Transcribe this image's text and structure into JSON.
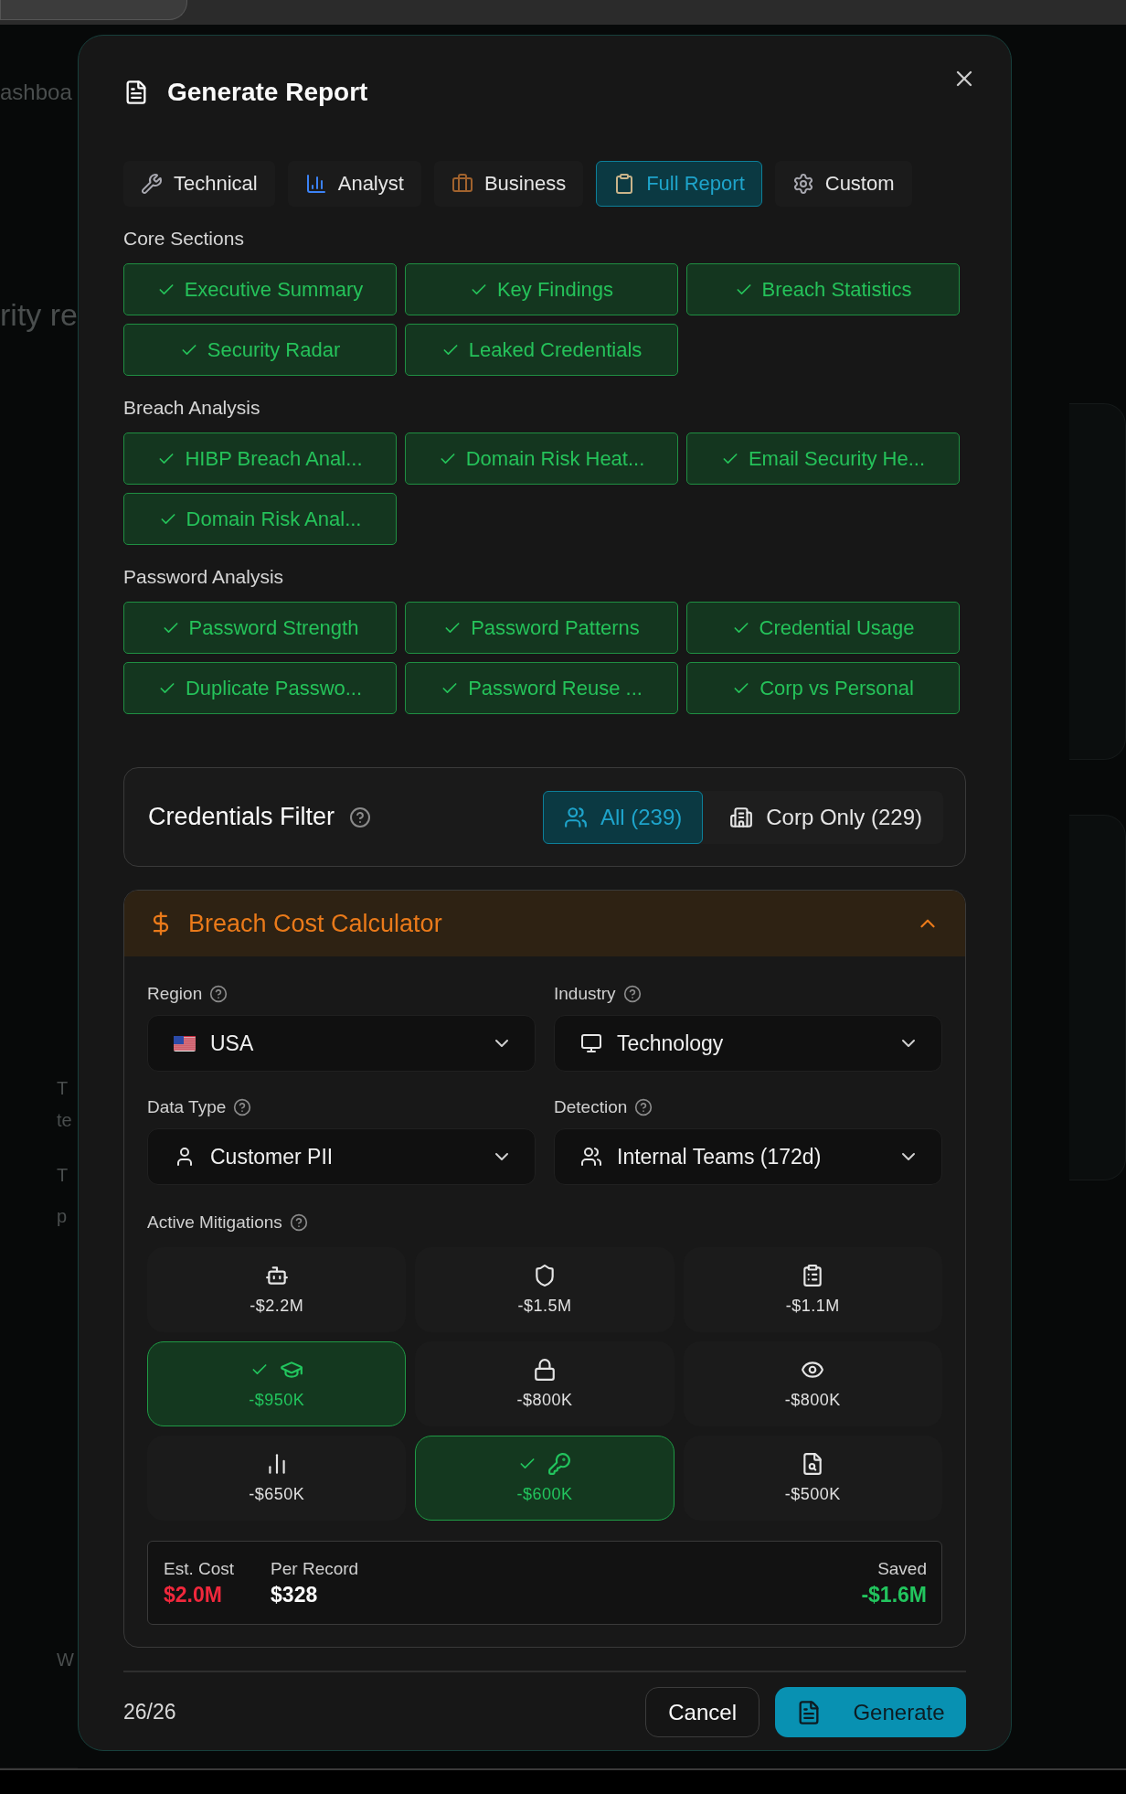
{
  "background": {
    "texts": [
      {
        "kind": "nav",
        "text": "ashboa"
      },
      {
        "kind": "heading",
        "text": "rity re"
      },
      {
        "kind": "line",
        "text": "T"
      },
      {
        "kind": "line",
        "text": "te"
      },
      {
        "kind": "line",
        "text": "T"
      },
      {
        "kind": "line",
        "text": "p"
      },
      {
        "kind": "line",
        "text": "W"
      }
    ]
  },
  "dialog": {
    "title": "Generate Report",
    "tabs": [
      {
        "kind": "wrench",
        "label": "Technical",
        "selected": false
      },
      {
        "kind": "chart",
        "label": "Analyst",
        "selected": false
      },
      {
        "kind": "briefcase",
        "label": "Business",
        "selected": false
      },
      {
        "kind": "clipboard",
        "label": "Full Report",
        "selected": true
      },
      {
        "kind": "gear",
        "label": "Custom",
        "selected": false
      }
    ],
    "sections": [
      {
        "title": "Core Sections",
        "items": [
          {
            "label": "Executive Summary",
            "checked": true
          },
          {
            "label": "Key Findings",
            "checked": true
          },
          {
            "label": "Breach Statistics",
            "checked": true
          },
          {
            "label": "Security Radar",
            "checked": true
          },
          {
            "label": "Leaked Credentials",
            "checked": true
          }
        ]
      },
      {
        "title": "Breach Analysis",
        "items": [
          {
            "label": "HIBP Breach Anal...",
            "checked": true
          },
          {
            "label": "Domain Risk Heat...",
            "checked": true
          },
          {
            "label": "Email Security He...",
            "checked": true
          },
          {
            "label": "Domain Risk Anal...",
            "checked": true
          }
        ]
      },
      {
        "title": "Password Analysis",
        "items": [
          {
            "label": "Password Strength",
            "checked": true
          },
          {
            "label": "Password Patterns",
            "checked": true
          },
          {
            "label": "Credential Usage",
            "checked": true
          },
          {
            "label": "Duplicate Passwo...",
            "checked": true
          },
          {
            "label": "Password Reuse ...",
            "checked": true
          },
          {
            "label": "Corp vs Personal",
            "checked": true
          }
        ]
      }
    ],
    "credentials_filter": {
      "title": "Credentials Filter",
      "options": [
        {
          "kind": "users",
          "label": "All (239)",
          "selected": true
        },
        {
          "kind": "building",
          "label": "Corp Only (229)",
          "selected": false
        }
      ]
    },
    "calculator": {
      "title": "Breach Cost Calculator",
      "expanded": true,
      "fields": [
        {
          "label": "Region",
          "kind": "flag",
          "value": "USA"
        },
        {
          "label": "Industry",
          "kind": "monitor",
          "value": "Technology"
        },
        {
          "label": "Data Type",
          "kind": "user",
          "value": "Customer PII"
        },
        {
          "label": "Detection",
          "kind": "users",
          "value": "Internal Teams (172d)"
        }
      ],
      "mitigations_label": "Active Mitigations",
      "mitigations": [
        {
          "kind": "bot",
          "value": "-$2.2M",
          "selected": false
        },
        {
          "kind": "shield",
          "value": "-$1.5M",
          "selected": false
        },
        {
          "kind": "clipboard",
          "value": "-$1.1M",
          "selected": false
        },
        {
          "kind": "cap",
          "value": "-$950K",
          "selected": true
        },
        {
          "kind": "lock",
          "value": "-$800K",
          "selected": false
        },
        {
          "kind": "eye",
          "value": "-$800K",
          "selected": false
        },
        {
          "kind": "chart",
          "value": "-$650K",
          "selected": false
        },
        {
          "kind": "key",
          "value": "-$600K",
          "selected": true
        },
        {
          "kind": "search",
          "value": "-$500K",
          "selected": false
        }
      ],
      "summary": {
        "est_cost_label": "Est. Cost",
        "est_cost": "$2.0M",
        "per_record_label": "Per Record",
        "per_record": "$328",
        "saved_label": "Saved",
        "saved": "-$1.6M"
      }
    },
    "footer": {
      "count": "26/26",
      "cancel": "Cancel",
      "generate": "Generate"
    }
  }
}
